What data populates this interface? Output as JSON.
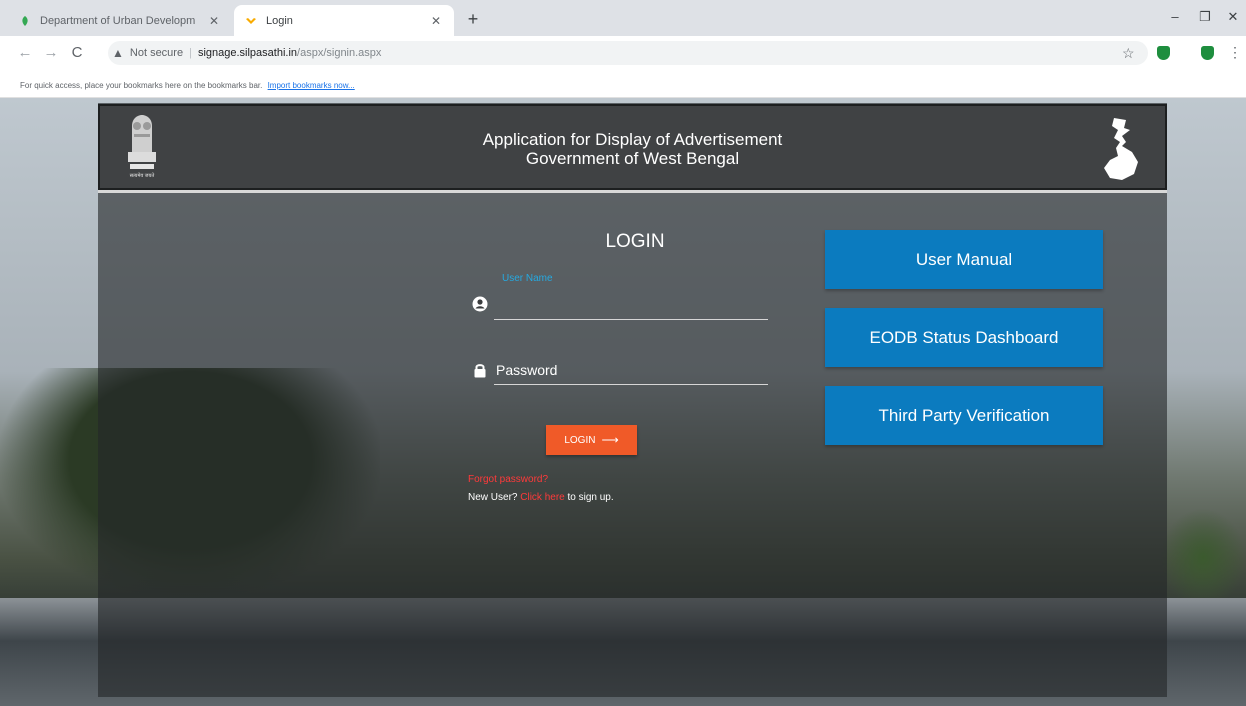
{
  "browser": {
    "tabs": [
      {
        "title": "Department of Urban Developm",
        "active": false
      },
      {
        "title": "Login",
        "active": true
      }
    ],
    "new_tab_icon": "+",
    "window": {
      "minimize": "–",
      "maximize": "❐",
      "close": "✕"
    },
    "address": {
      "security_label": "Not secure",
      "host": "signage.silpasathi.in",
      "path": "/aspx/signin.aspx"
    },
    "bookmarks_bar": {
      "text": "For quick access, place your bookmarks here on the bookmarks bar.",
      "link": "Import bookmarks now..."
    }
  },
  "header": {
    "title_line1": "Application for Display of Advertisement",
    "title_line2": "Government of West Bengal",
    "emblem_caption": "सत्यमेव जयते"
  },
  "login": {
    "title": "LOGIN",
    "username_label": "User Name",
    "username_value": "",
    "password_placeholder": "Password",
    "password_value": "",
    "button_label": "LOGIN",
    "forgot_password": "Forgot password?",
    "signup_prefix": "New User?",
    "signup_link": "Click here",
    "signup_suffix": "to sign up."
  },
  "side_buttons": [
    {
      "label": "User Manual"
    },
    {
      "label": "EODB Status Dashboard"
    },
    {
      "label": "Third Party Verification"
    }
  ],
  "colors": {
    "accent_orange": "#f05a28",
    "side_button_blue": "#0b7bbf",
    "label_blue": "#26a9e0",
    "link_red": "#ff3a3a"
  },
  "icons": {
    "user_field": "user-circle-icon",
    "password_field": "lock-icon",
    "login_arrow": "arrow-right-icon"
  }
}
